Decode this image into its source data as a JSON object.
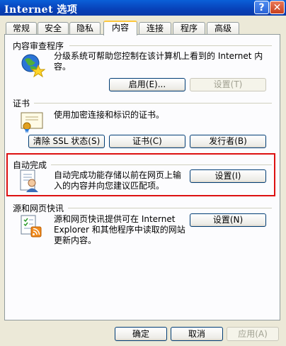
{
  "window": {
    "title": "Internet 选项",
    "help_label": "?",
    "close_label": "✕"
  },
  "tabs": [
    "常规",
    "安全",
    "隐私",
    "内容",
    "连接",
    "程序",
    "高级"
  ],
  "sections": {
    "content_advisor": {
      "title": "内容审查程序",
      "description": "分级系统可帮助您控制在该计算机上看到的 Internet 内容。",
      "desc_line1": "分级系统可帮助您控制在该计算机上看到的 Internet 内",
      "desc_line2": "容。",
      "enable_label": "启用(E)...",
      "settings_label": "设置(T)"
    },
    "certificates": {
      "title": "证书",
      "description": "使用加密连接和标识的证书。",
      "clear_ssl_label": "清除 SSL 状态(S)",
      "certificates_label": "证书(C)",
      "publishers_label": "发行者(B)"
    },
    "autocomplete": {
      "title": "自动完成",
      "desc_line1": "自动完成功能存储以前在网页上输",
      "desc_line2": "入的内容并向您建议匹配项。",
      "settings_label": "设置(I)"
    },
    "feeds": {
      "title": "源和网页快讯",
      "desc_line1": "源和网页快讯提供可在 Internet",
      "desc_line2": "Explorer 和其他程序中读取的网站",
      "desc_line3": "更新内容。",
      "settings_label": "设置(N)"
    }
  },
  "footer": {
    "ok_label": "确定",
    "cancel_label": "取消",
    "apply_label": "应用(A)"
  },
  "colors": {
    "highlight": "#dd1111",
    "titlebar": "#0841b8",
    "active_tab_accent": "#ffc83c"
  }
}
